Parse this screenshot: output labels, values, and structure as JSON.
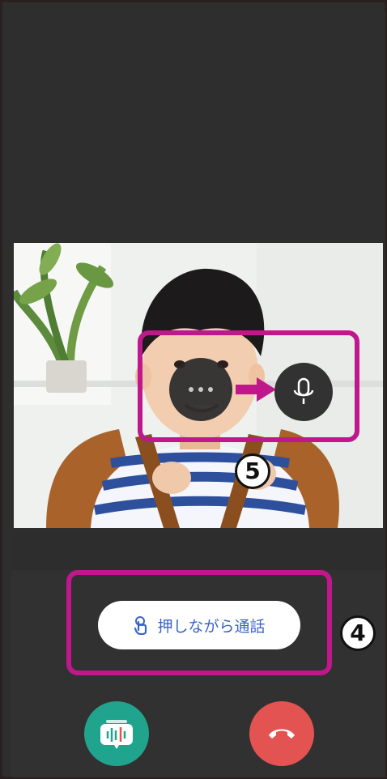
{
  "controls": {
    "push_to_talk_label": "押しながら通話"
  },
  "annotations": {
    "callout_4_number": "4",
    "callout_5_number": "5"
  },
  "icons": {
    "more": "more-dots-icon",
    "arrow": "arrow-right-icon",
    "mic": "microphone-icon",
    "touch": "touch-hand-icon",
    "transcribe": "audio-bubble-icon",
    "hangup": "phone-hangup-icon"
  },
  "colors": {
    "callout": "#c0178c",
    "accent_blue": "#3a63c8",
    "transcribe_green": "#21a48d",
    "hangup_red": "#e35352",
    "background": "#2f2e2f"
  }
}
